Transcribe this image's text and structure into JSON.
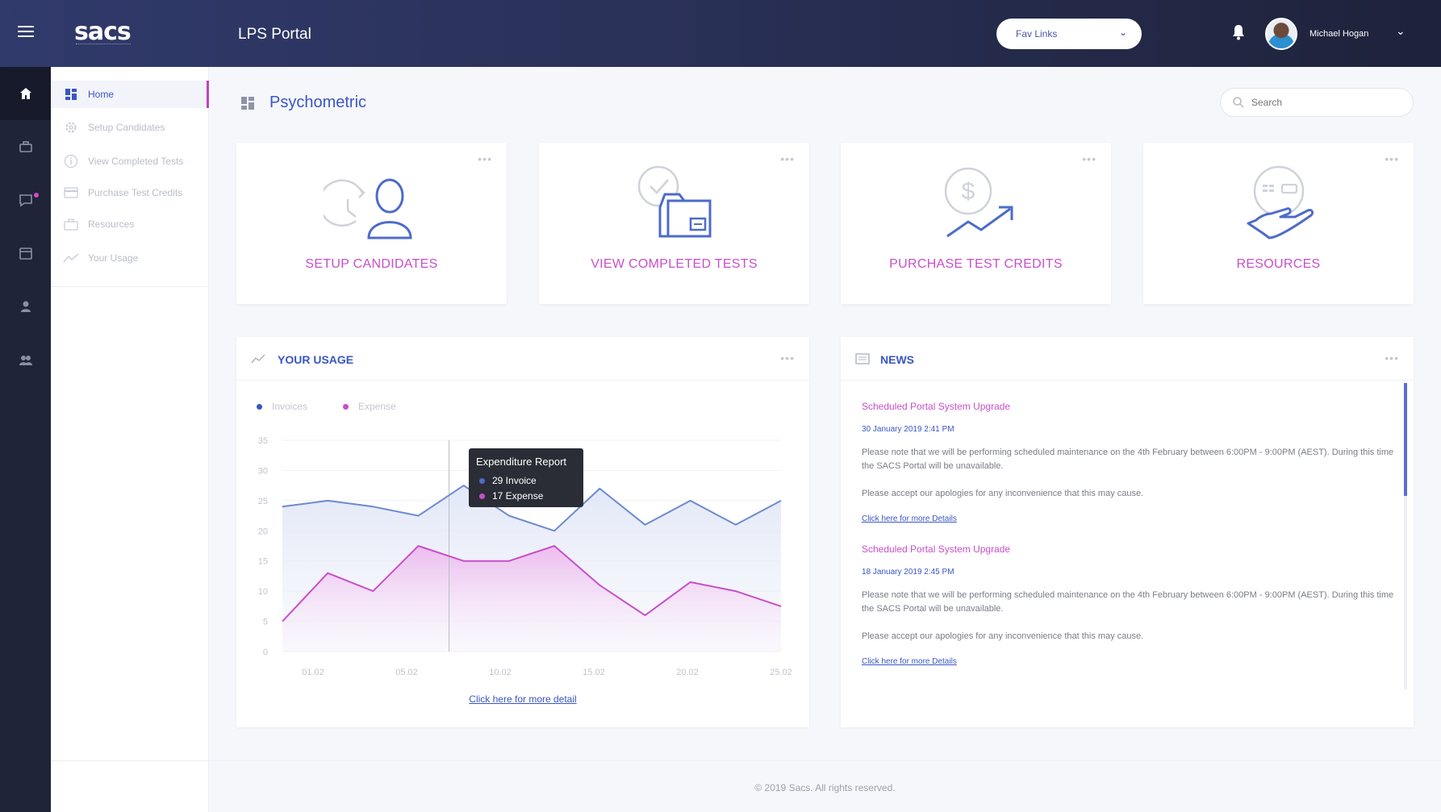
{
  "header": {
    "logo": "sacs",
    "app_title": "LPS Portal",
    "fav_links_label": "Fav Links",
    "user_name": "Michael Hogan"
  },
  "sidebar": {
    "items": [
      {
        "label": "Home",
        "icon": "dashboard-icon",
        "active": true
      },
      {
        "label": "Setup Candidates",
        "icon": "gear-icon"
      },
      {
        "label": "View Completed Tests",
        "icon": "info-icon"
      },
      {
        "label": "Purchase Test Credits",
        "icon": "credit-card-icon"
      },
      {
        "label": "Resources",
        "icon": "briefcase-icon"
      },
      {
        "label": "Your Usage",
        "icon": "trend-icon"
      }
    ],
    "rail_icons": [
      "home-icon",
      "briefcase-icon",
      "chat-icon",
      "calendar-icon",
      "user-icon",
      "users-icon"
    ]
  },
  "page": {
    "title": "Psychometric",
    "search_placeholder": "Search"
  },
  "cards": [
    {
      "label": "SETUP CANDIDATES",
      "icon": "user-refresh-icon"
    },
    {
      "label": "VIEW COMPLETED TESTS",
      "icon": "folder-check-icon"
    },
    {
      "label": "PURCHASE TEST CREDITS",
      "icon": "dollar-growth-icon"
    },
    {
      "label": "RESOURCES",
      "icon": "hand-resources-icon"
    }
  ],
  "usage": {
    "title": "YOUR USAGE",
    "link": "Click here for more detail",
    "tooltip": {
      "title": "Expenditure Report",
      "invoice": "29 Invoice",
      "expense": "17 Expense"
    }
  },
  "chart_data": {
    "type": "area",
    "x": [
      "01.02",
      "05.02",
      "10.02",
      "15.02",
      "20.02",
      "25.02"
    ],
    "ylim": [
      0,
      35
    ],
    "yticks": [
      0,
      5,
      10,
      15,
      20,
      25,
      30,
      35
    ],
    "series": [
      {
        "name": "Invoices",
        "color": "#6c8ad0",
        "values": [
          24,
          25,
          24,
          22.5,
          27.5,
          22.5,
          20,
          27,
          21,
          25,
          21,
          25
        ]
      },
      {
        "name": "Expense",
        "color": "#c84fc8",
        "values": [
          5,
          13,
          10,
          17.5,
          15,
          15,
          17.5,
          11,
          6,
          11.5,
          10,
          7.5
        ]
      }
    ],
    "legend": "top-left",
    "grid": true
  },
  "news": {
    "title": "NEWS",
    "items": [
      {
        "title": "Scheduled Portal System Upgrade",
        "date": "30 January 2019 2:41 PM",
        "body1": "Please note that we will be performing scheduled maintenance on the 4th February between 6:00PM - 9:00PM (AEST). During this time the SACS Portal will be unavailable.",
        "body2": "Please accept our apologies for any inconvenience that this may cause.",
        "link": "Click here for more Details"
      },
      {
        "title": "Scheduled Portal System Upgrade",
        "date": "18 January 2019 2:45 PM",
        "body1": "Please note that we will be performing scheduled maintenance on the 4th February between 6:00PM - 9:00PM (AEST). During this time the SACS Portal will be unavailable.",
        "body2": "Please accept our apologies for any inconvenience that this may cause.",
        "link": "Click here for more Details"
      }
    ]
  },
  "footer": {
    "text": "© 2019 Sacs. All rights reserved."
  }
}
